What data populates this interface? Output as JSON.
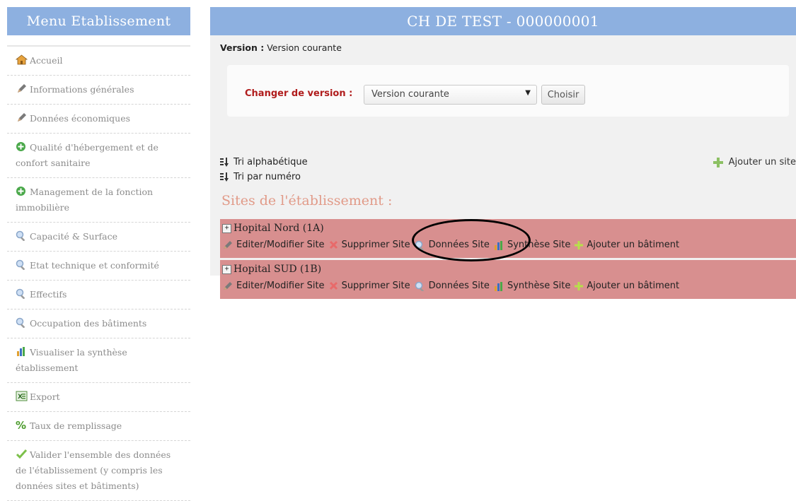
{
  "sidebar": {
    "title": "Menu Etablissement",
    "items": [
      {
        "label": "Accueil",
        "icon": "home-icon"
      },
      {
        "label": "Informations générales",
        "icon": "pencil-icon"
      },
      {
        "label": "Données économiques",
        "icon": "pencil-icon"
      },
      {
        "label": "Qualité d'hébergement et de confort sanitaire",
        "icon": "plus-circle-icon"
      },
      {
        "label": "Management de la fonction immobilière",
        "icon": "plus-circle-icon"
      },
      {
        "label": "Capacité & Surface",
        "icon": "magnifier-icon"
      },
      {
        "label": "Etat technique et conformité",
        "icon": "magnifier-icon"
      },
      {
        "label": "Effectifs",
        "icon": "magnifier-icon"
      },
      {
        "label": "Occupation des bâtiments",
        "icon": "magnifier-icon"
      },
      {
        "label": "Visualiser la synthèse établissement",
        "icon": "bar-chart-icon"
      },
      {
        "label": "Export",
        "icon": "excel-icon"
      },
      {
        "label": "Taux de remplissage",
        "icon": "percent-icon"
      },
      {
        "label": "Valider l'ensemble des données de l'établissement (y compris les données sites et bâtiments)",
        "icon": "checkmark-icon"
      }
    ]
  },
  "header": {
    "title": "CH DE TEST - 000000001"
  },
  "version": {
    "label": "Version :",
    "value": "Version courante",
    "change_label": "Changer de version :",
    "selected": "Version courante",
    "choose_button": "Choisir"
  },
  "sort": {
    "alpha": "Tri alphabétique",
    "number": "Tri par numéro"
  },
  "add_site": "Ajouter un site",
  "sites_title": "Sites de l'établissement :",
  "sites": [
    {
      "name": "Hopital Nord (1A)"
    },
    {
      "name": "Hopital SUD (1B)"
    }
  ],
  "actions": {
    "edit": "Editer/Modifier Site",
    "delete": "Supprimer Site",
    "data": "Données Site",
    "synthesis": "Synthèse Site",
    "add_building": "Ajouter un bâtiment"
  },
  "colors": {
    "header_bg": "#8db0e0",
    "site_row_bg": "#d88f8f",
    "accent_red": "#b01c1c",
    "sites_title": "#e19a88"
  }
}
